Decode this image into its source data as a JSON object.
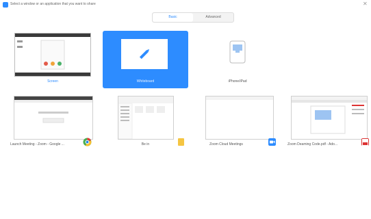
{
  "window": {
    "title": "Select a window or an application that you want to share",
    "close_glyph": "✕"
  },
  "tabs": [
    {
      "label": "Basic",
      "active": true
    },
    {
      "label": "Advanced",
      "active": false
    }
  ],
  "share_options": [
    {
      "label": "Screen",
      "icon": "desktop-icon"
    },
    {
      "label": "Whiteboard",
      "icon": "pencil-icon",
      "selected": true
    },
    {
      "label": "iPhone/iPad",
      "icon": "phone-icon"
    }
  ],
  "windows": [
    {
      "label": "Launch Meeting - Zoom - Google ...",
      "icon": "chrome-icon"
    },
    {
      "label": "Be in",
      "icon": "folder-icon"
    },
    {
      "label": "Zoom Cloud Meetings",
      "icon": "zoom-icon"
    },
    {
      "label": "Zoom Deaming Code.pdf - Ado...",
      "icon": "pdf-icon"
    }
  ],
  "colors": {
    "accent": "#2d8cff",
    "background": "#ffffff"
  }
}
